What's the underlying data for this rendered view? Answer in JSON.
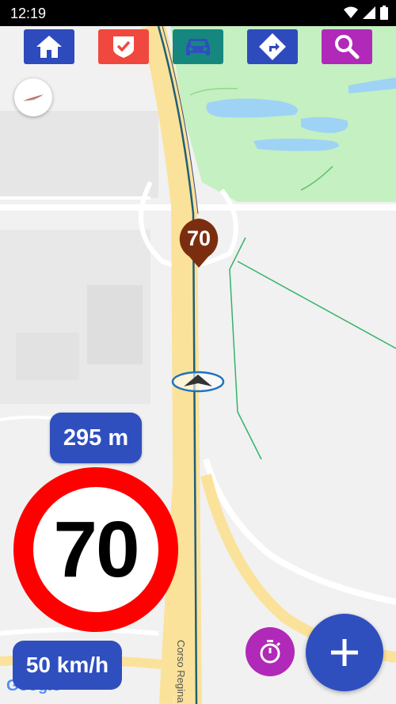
{
  "status_bar": {
    "time": "12:19",
    "icons": [
      "wifi-icon",
      "signal-icon",
      "battery-icon"
    ]
  },
  "toolbar": {
    "buttons": [
      {
        "name": "home",
        "icon": "home-icon",
        "color": "#2e4bbd"
      },
      {
        "name": "check",
        "icon": "check-shield-icon",
        "color": "#f0483e"
      },
      {
        "name": "car",
        "icon": "car-icon",
        "color": "#16877f"
      },
      {
        "name": "route",
        "icon": "turn-right-icon",
        "color": "#2e4bbd"
      },
      {
        "name": "search",
        "icon": "search-icon",
        "color": "#b129b8"
      }
    ]
  },
  "map": {
    "compass_icon": "compass-icon",
    "speed_camera_pin": {
      "label": "70",
      "color": "#7b2e0f"
    },
    "street_name": "Corso Regina",
    "attribution": "Google"
  },
  "hud": {
    "distance": "295 m",
    "speed_limit": "70",
    "current_speed": "50 km/h",
    "accent_color": "#2f4fbf",
    "sign_border_color": "#ff0000"
  },
  "actions": {
    "timer_icon": "stopwatch-icon",
    "add_icon": "plus-icon"
  }
}
